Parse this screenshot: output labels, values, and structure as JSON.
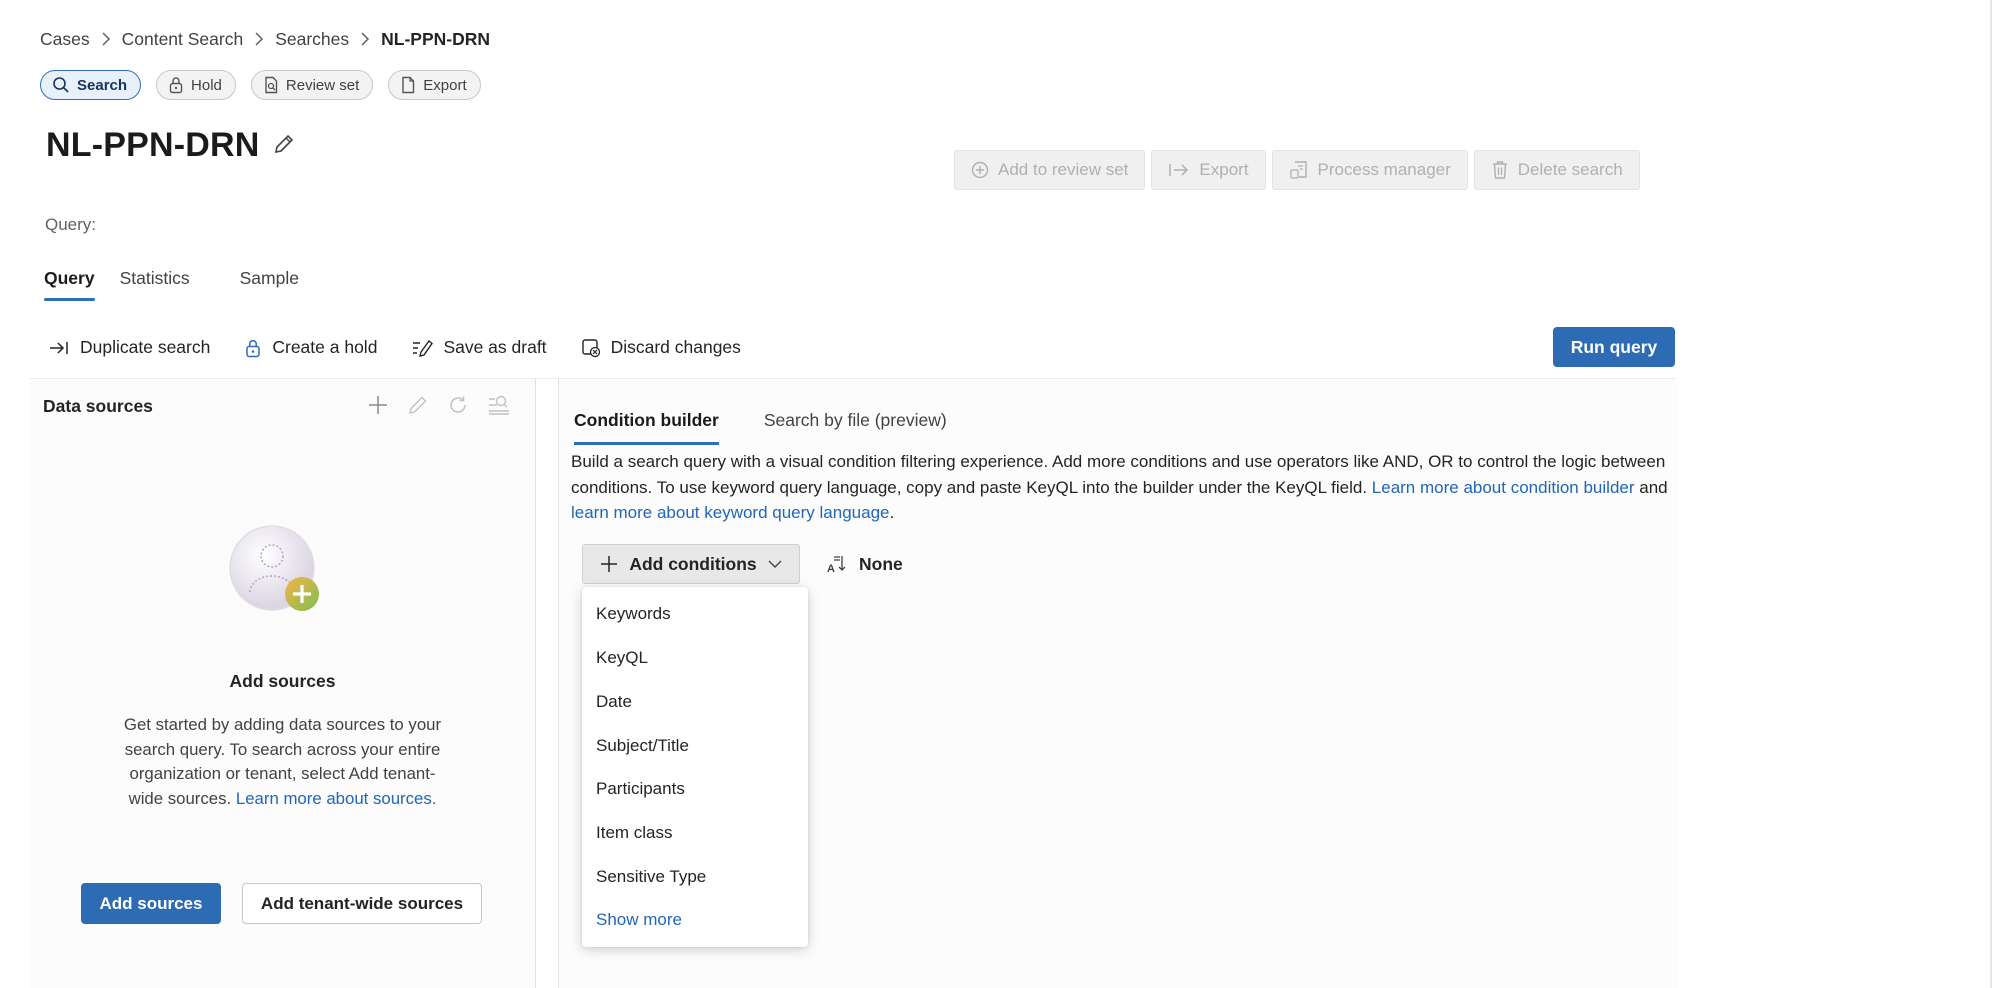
{
  "breadcrumb": {
    "items": [
      "Cases",
      "Content Search",
      "Searches"
    ],
    "current": "NL-PPN-DRN"
  },
  "stage_pills": [
    {
      "label": "Search",
      "icon": "search-icon",
      "active": true
    },
    {
      "label": "Hold",
      "icon": "lock-icon",
      "active": false
    },
    {
      "label": "Review set",
      "icon": "document-search-icon",
      "active": false
    },
    {
      "label": "Export",
      "icon": "document-icon",
      "active": false
    }
  ],
  "page": {
    "title": "NL-PPN-DRN",
    "query_label": "Query:"
  },
  "top_actions": {
    "add_to_review_set": "Add to review set",
    "export": "Export",
    "process_manager": "Process manager",
    "delete_search": "Delete search"
  },
  "tabs": [
    "Query",
    "Statistics",
    "Sample"
  ],
  "toolbar": {
    "duplicate_search": "Duplicate search",
    "create_hold": "Create a hold",
    "save_draft": "Save as draft",
    "discard_changes": "Discard changes",
    "run_query": "Run query"
  },
  "data_sources": {
    "title": "Data sources",
    "empty_title": "Add sources",
    "empty_text": "Get started by adding data sources to your search query. To search across your entire organization or tenant, select Add tenant-wide sources.",
    "learn_more": "Learn more about sources.",
    "add_sources": "Add sources",
    "add_tenant_wide": "Add tenant-wide sources"
  },
  "condition_builder": {
    "tabs": [
      "Condition builder",
      "Search by file (preview)"
    ],
    "description": "Build a search query with a visual condition filtering experience. Add more conditions and use operators like AND, OR to control the logic between conditions. To use keyword query language, copy and paste KeyQL into the builder under the KeyQL field.",
    "link1": "Learn more about condition builder",
    "connector": "and",
    "link2": "learn more about keyword query language",
    "end": ".",
    "add_conditions": "Add conditions",
    "none_label": "None",
    "menu_items": [
      "Keywords",
      "KeyQL",
      "Date",
      "Subject/Title",
      "Participants",
      "Item class",
      "Sensitive Type"
    ],
    "show_more": "Show more"
  },
  "colors": {
    "primary": "#2d6bb5",
    "link": "#2166b8",
    "disabled_text": "#b0b0b0"
  }
}
